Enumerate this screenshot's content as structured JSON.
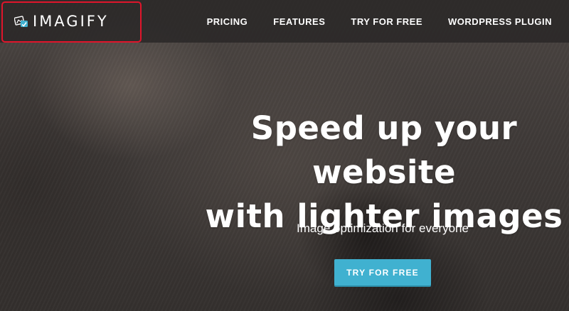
{
  "header": {
    "logo_text": "IMAGIFY",
    "logo_icon": "photo-icon",
    "nav": {
      "pricing": "PRICING",
      "features": "FEATURES",
      "try_for_free": "TRY FOR FREE",
      "wordpress_plugin": "WORDPRESS PLUGIN"
    }
  },
  "hero": {
    "title_line1": "Speed up your website",
    "title_line2": "with lighter images",
    "subtitle": "Image optimization for everyone",
    "cta_label": "TRY FOR FREE"
  },
  "colors": {
    "cta": "#40b1d0",
    "highlight": "#e0152b",
    "header_bg": "#2a2828"
  }
}
